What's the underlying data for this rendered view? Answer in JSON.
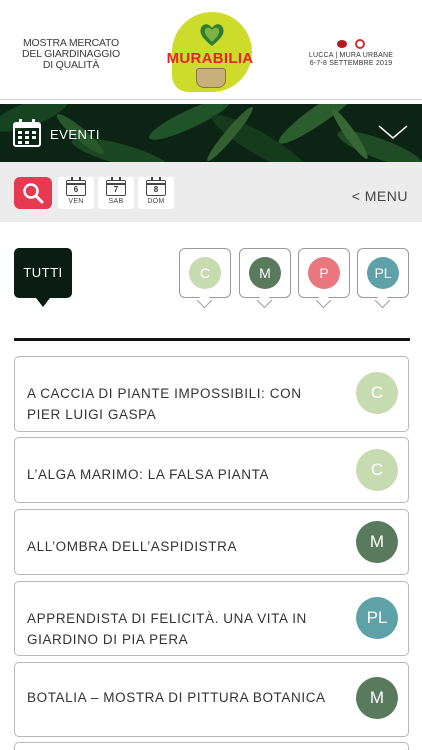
{
  "header": {
    "tagline": [
      "MOSTRA MERCATO",
      "DEL GIARDINAGGIO",
      "DI QUALITÀ"
    ],
    "logo_text": "MURABILIA",
    "place": "LUCCA | MURA URBANE",
    "dates": "6-7-8 SETTEMBRE 2019"
  },
  "banner": {
    "label": "EVENTI",
    "icon": "calendar-icon"
  },
  "toolbar": {
    "search_icon": "search-icon",
    "days": [
      {
        "num": "6",
        "name": "VEN"
      },
      {
        "num": "7",
        "name": "SAB"
      },
      {
        "num": "8",
        "name": "DOM"
      }
    ],
    "menu_label": "< MENU"
  },
  "filters": {
    "all_label": "TUTTI",
    "categories": [
      {
        "code": "C",
        "color": "#c7dbb0"
      },
      {
        "code": "M",
        "color": "#5a7a5e"
      },
      {
        "code": "P",
        "color": "#e8787e"
      },
      {
        "code": "PL",
        "color": "#5ea2a8"
      }
    ]
  },
  "events": [
    {
      "title": "A CACCIA DI PIANTE IMPOSSIBILI: CON PIER LUIGI GASPA",
      "code": "C",
      "color": "#c7dbb0"
    },
    {
      "title": "L’ALGA MARIMO: LA FALSA PIANTA",
      "code": "C",
      "color": "#c7dbb0"
    },
    {
      "title": "ALL’OMBRA DELL’ASPIDISTRA",
      "code": "M",
      "color": "#5a7a5e"
    },
    {
      "title": "APPRENDISTA DI FELICITÀ. UNA VITA IN GIARDINO DI PIA PERA",
      "code": "PL",
      "color": "#5ea2a8"
    },
    {
      "title": "BOTALIA – MOSTRA DI PITTURA BOTANICA",
      "code": "M",
      "color": "#5a7a5e"
    }
  ],
  "colors": {
    "accent": "#e53a4f",
    "dark": "#0b1c14",
    "brand_red": "#e0262a",
    "brand_lime": "#cddc2a"
  }
}
